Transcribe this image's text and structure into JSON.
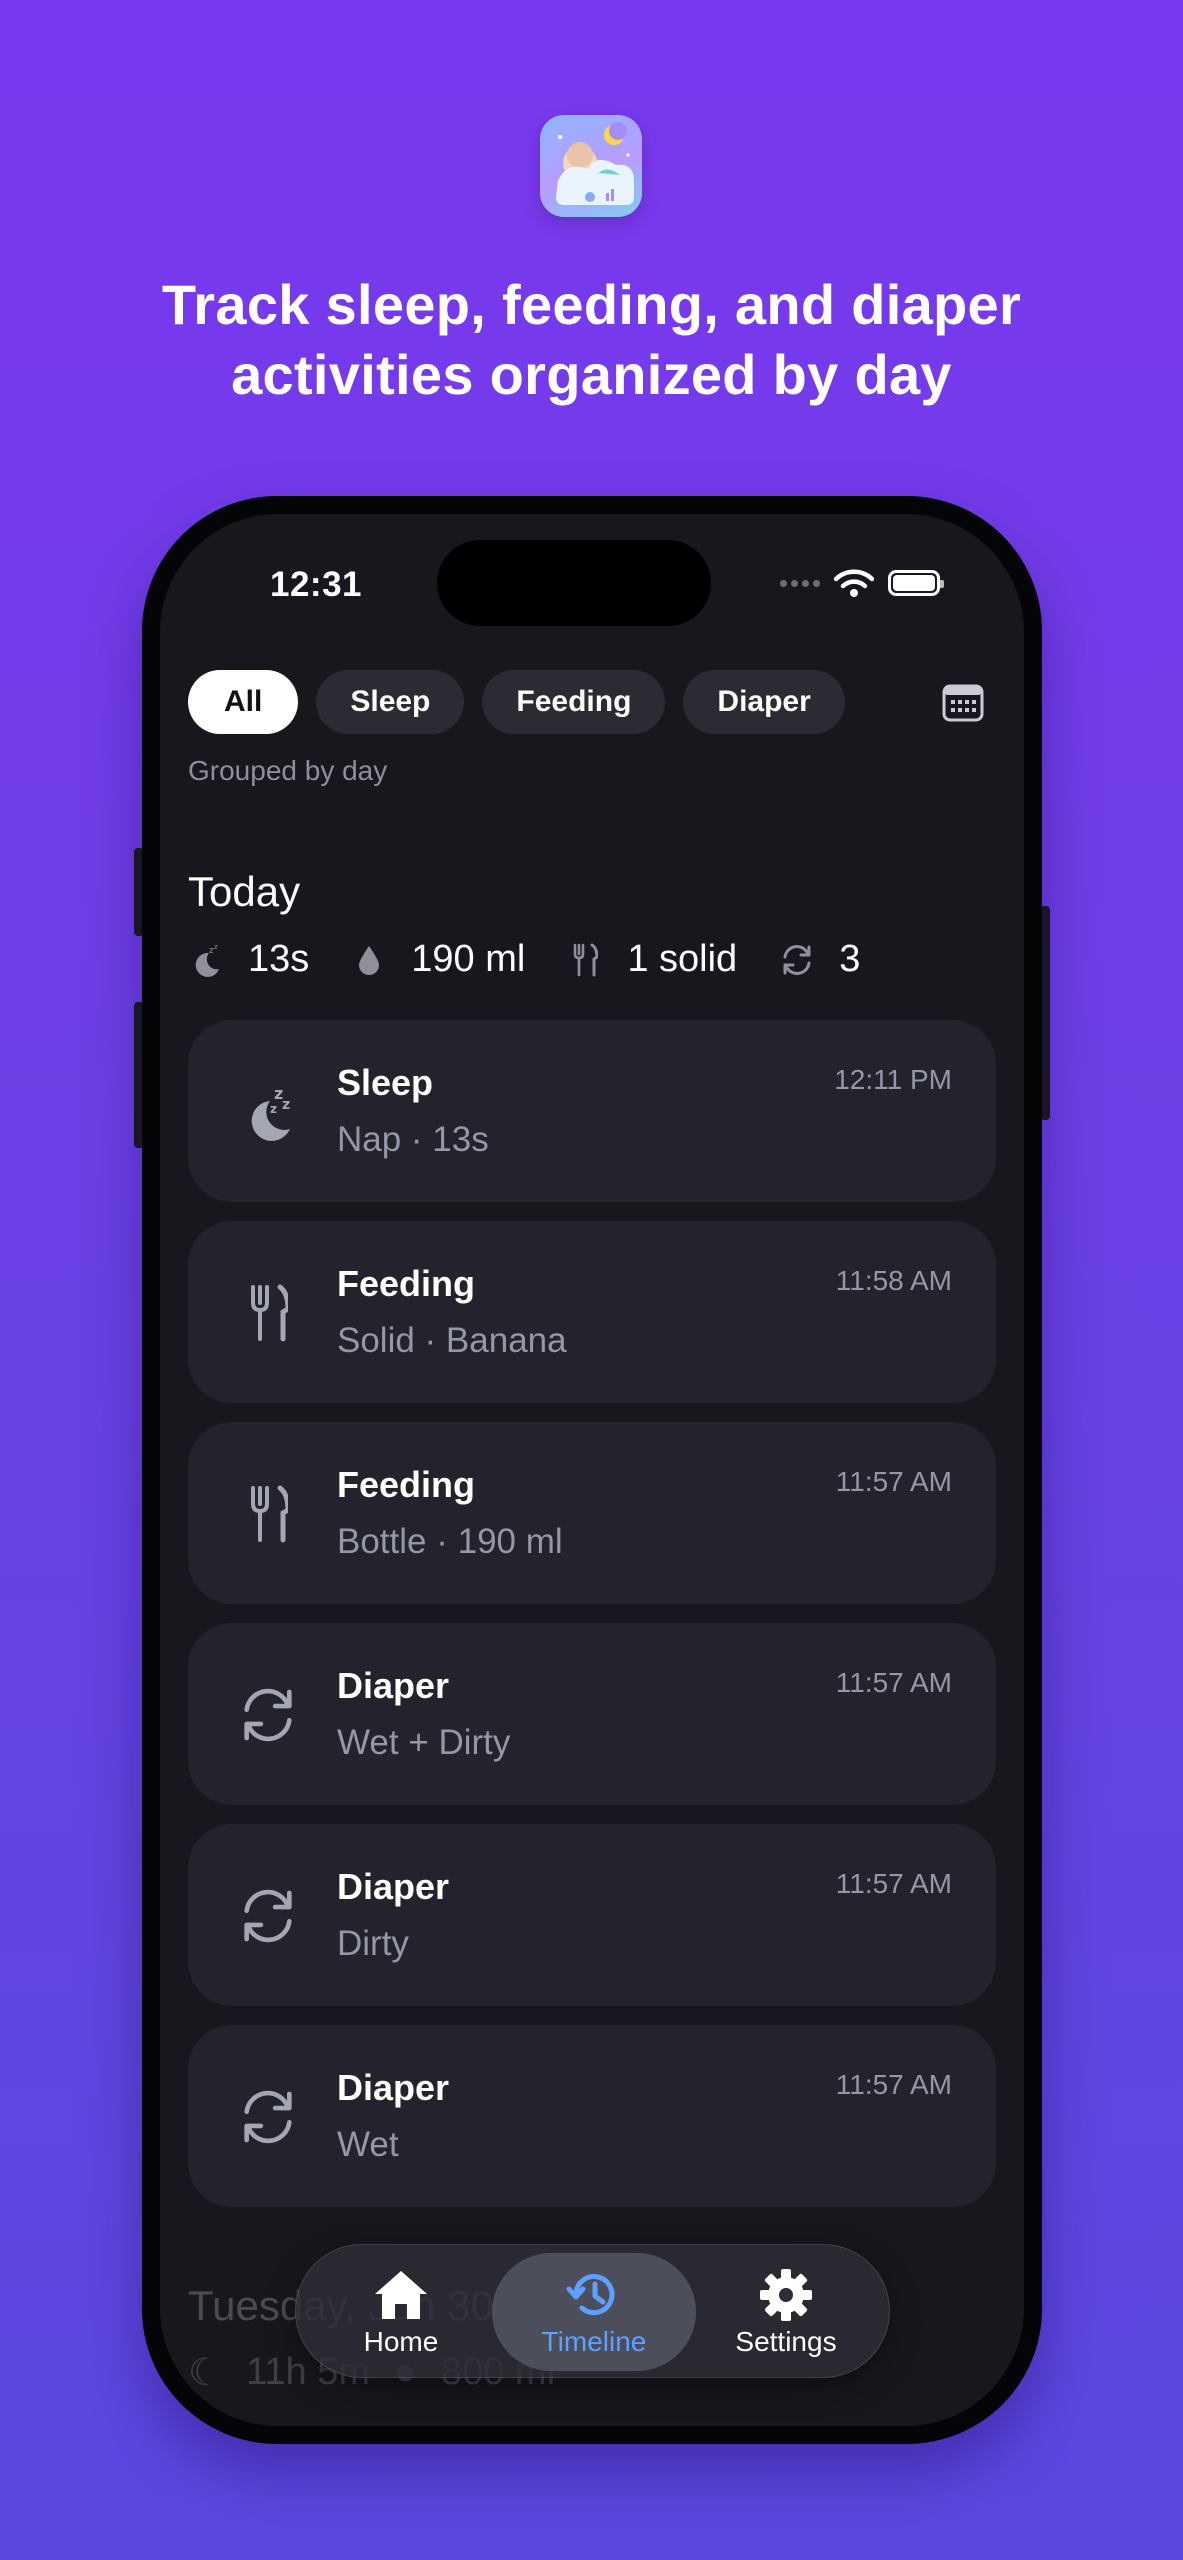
{
  "hero": {
    "headline": "Track sleep, feeding, and diaper activities organized by day",
    "app_icon": "baby-sleeping-on-cloud-icon"
  },
  "status_bar": {
    "time": "12:31"
  },
  "filters": {
    "chips": [
      "All",
      "Sleep",
      "Feeding",
      "Diaper"
    ],
    "selected": "All",
    "calendar_icon": "calendar-icon",
    "note": "Grouped by day"
  },
  "today": {
    "title": "Today",
    "summary": {
      "sleep": "13s",
      "bottle": "190 ml",
      "solid": "1 solid",
      "diapers": "3"
    }
  },
  "entries": [
    {
      "title": "Sleep",
      "detail": "Nap · 13s",
      "time": "12:11 PM",
      "icon": "moon-zzz-icon"
    },
    {
      "title": "Feeding",
      "detail": "Solid · Banana",
      "time": "11:58 AM",
      "icon": "fork-knife-icon"
    },
    {
      "title": "Feeding",
      "detail": "Bottle · 190 ml",
      "time": "11:57 AM",
      "icon": "fork-knife-icon"
    },
    {
      "title": "Diaper",
      "detail": "Wet + Dirty",
      "time": "11:57 AM",
      "icon": "arrows-cycle-icon"
    },
    {
      "title": "Diaper",
      "detail": "Dirty",
      "time": "11:57 AM",
      "icon": "arrows-cycle-icon"
    },
    {
      "title": "Diaper",
      "detail": "Wet",
      "time": "11:57 AM",
      "icon": "arrows-cycle-icon"
    }
  ],
  "next_day": {
    "title": "Tuesday, Jun 30",
    "sleep": "11h 5m",
    "bottle": "800 ml"
  },
  "tabbar": {
    "tabs": [
      {
        "label": "Home",
        "icon": "house-icon"
      },
      {
        "label": "Timeline",
        "icon": "clock-history-icon"
      },
      {
        "label": "Settings",
        "icon": "gear-icon"
      }
    ],
    "selected": "Timeline"
  },
  "colors": {
    "background_top": "#7a38ee",
    "background_bottom": "#5a48e0",
    "screen": "#17171d",
    "card": "#22232d",
    "accent": "#5ea0ff"
  }
}
